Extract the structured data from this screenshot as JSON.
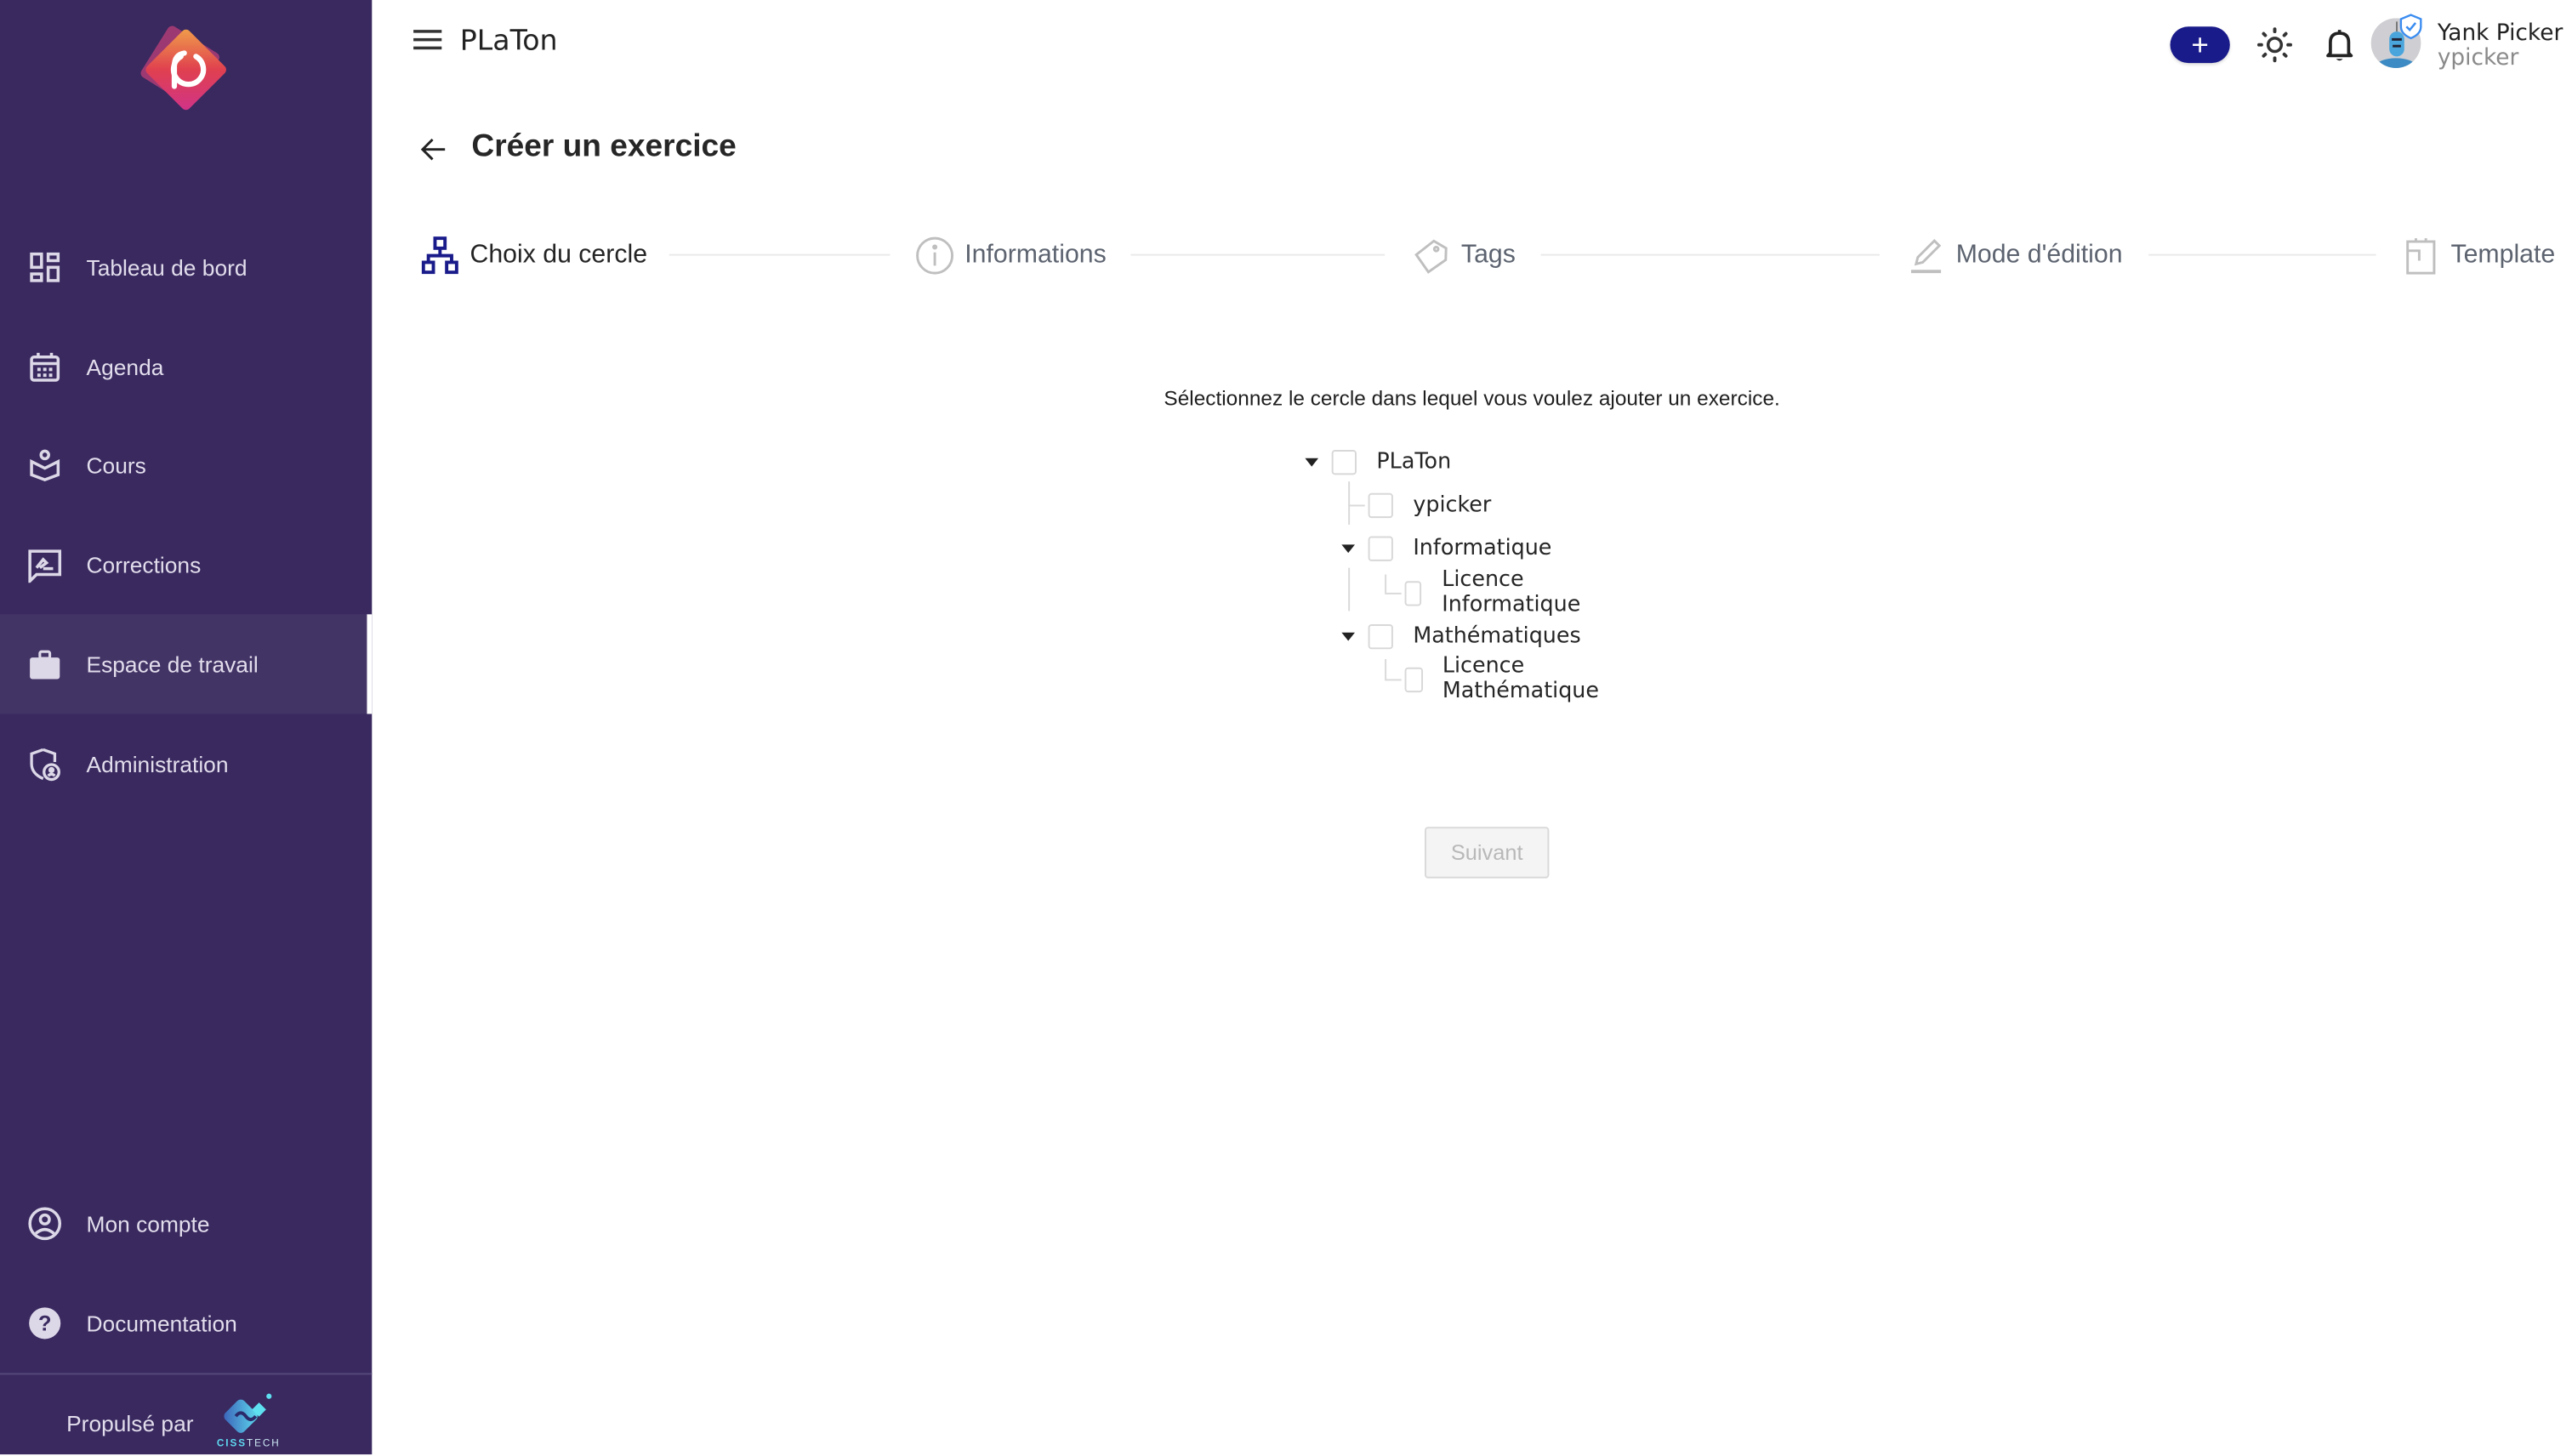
{
  "header": {
    "app_title": "PLaTon",
    "user": {
      "name": "Yank Picker",
      "login": "ypicker"
    },
    "add_label": "+"
  },
  "sidebar": {
    "items": [
      {
        "label": "Tableau de bord",
        "icon": "dashboard-icon",
        "active": false
      },
      {
        "label": "Agenda",
        "icon": "calendar-icon",
        "active": false
      },
      {
        "label": "Cours",
        "icon": "course-book-icon",
        "active": false
      },
      {
        "label": "Corrections",
        "icon": "corrections-icon",
        "active": false
      },
      {
        "label": "Espace de travail",
        "icon": "briefcase-icon",
        "active": true
      },
      {
        "label": "Administration",
        "icon": "admin-shield-icon",
        "active": false
      },
      {
        "label": "Mon compte",
        "icon": "account-icon",
        "active": false
      },
      {
        "label": "Documentation",
        "icon": "help-icon",
        "active": false
      }
    ],
    "powered_by": "Propulsé par",
    "powered_brand_bold": "CISS",
    "powered_brand_rest": "TECH"
  },
  "page": {
    "title": "Créer un exercice",
    "steps": [
      {
        "label": "Choix du cercle",
        "icon": "hierarchy-icon",
        "active": true
      },
      {
        "label": "Informations",
        "icon": "info-icon",
        "active": false
      },
      {
        "label": "Tags",
        "icon": "tag-icon",
        "active": false
      },
      {
        "label": "Mode d'édition",
        "icon": "edit-icon",
        "active": false
      },
      {
        "label": "Template",
        "icon": "clipboard-icon",
        "active": false
      }
    ],
    "instruction": "Sélectionnez le cercle dans lequel vous voulez ajouter un exercice.",
    "tree": [
      {
        "label": "PLaTon",
        "level": 0,
        "expanded": true,
        "checked": false
      },
      {
        "label": "ypicker",
        "level": 1,
        "expanded": null,
        "checked": false
      },
      {
        "label": "Informatique",
        "level": 1,
        "expanded": true,
        "checked": false
      },
      {
        "label": "Licence Informatique",
        "level": 2,
        "expanded": null,
        "checked": false
      },
      {
        "label": "Mathématiques",
        "level": 1,
        "expanded": true,
        "checked": false
      },
      {
        "label": "Licence Mathématique",
        "level": 2,
        "expanded": null,
        "checked": false
      }
    ],
    "next_label": "Suivant",
    "next_disabled": true
  },
  "colors": {
    "sidebar_bg": "#39295f",
    "sidebar_active_bg": "#433466",
    "accent": "#1a1b8a"
  }
}
